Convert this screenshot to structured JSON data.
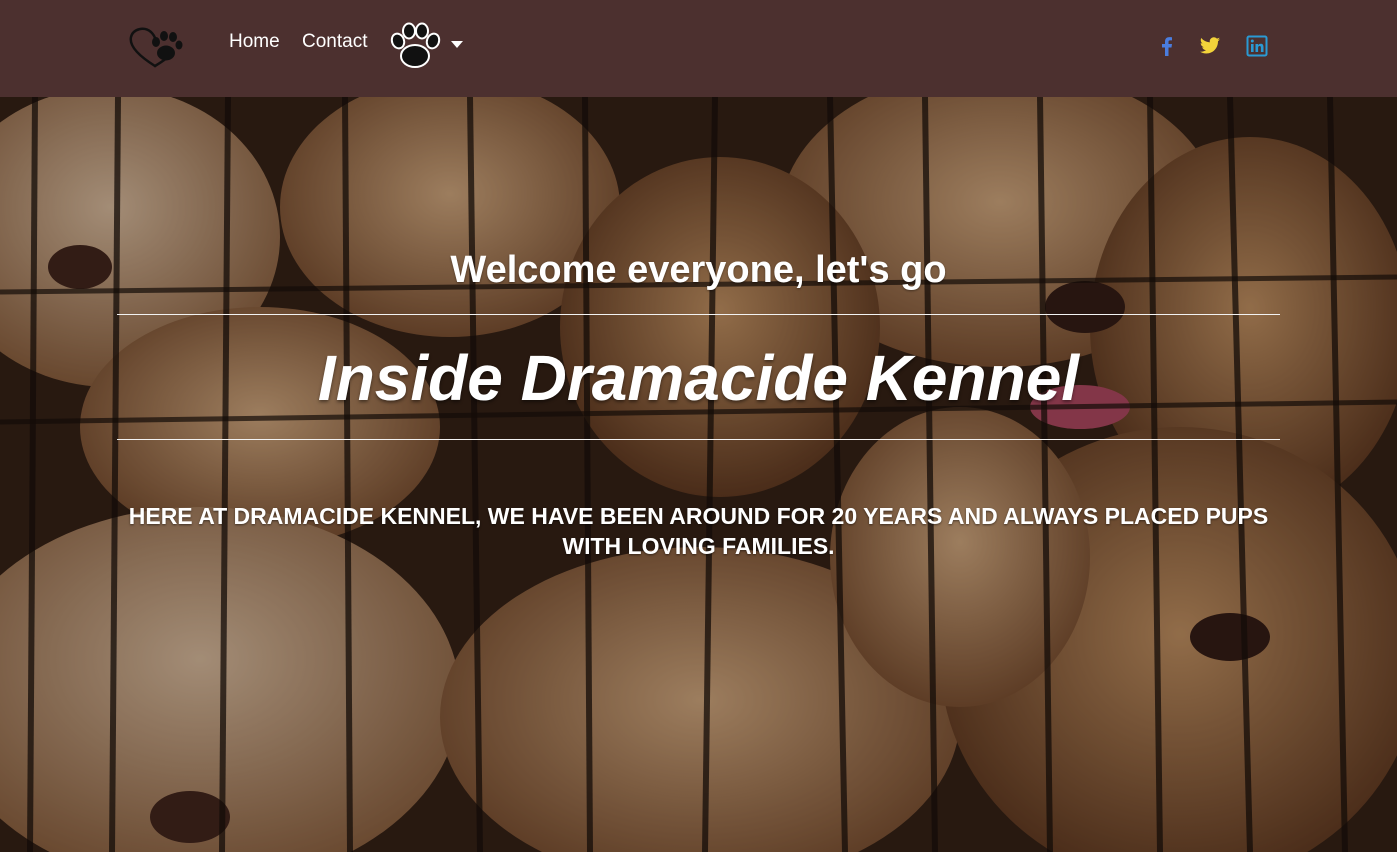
{
  "nav": {
    "logo_icon": "heart-paw-icon",
    "links": [
      {
        "label": "Home"
      },
      {
        "label": "Contact"
      }
    ],
    "dropdown": {
      "icon": "paw-print-icon",
      "caret_icon": "caret-down-icon"
    },
    "social": [
      {
        "icon": "facebook-icon",
        "color": "#4a7ddf"
      },
      {
        "icon": "twitter-icon",
        "color": "#f2d33a"
      },
      {
        "icon": "linkedin-icon",
        "color": "#2a9ad4"
      }
    ],
    "background_color": "#4c302f"
  },
  "hero": {
    "background_image": "puppies-in-kennel-photo",
    "welcome": "Welcome everyone, let's go",
    "title": "Inside Dramacide Kennel",
    "description": "HERE AT DRAMACIDE KENNEL, WE HAVE BEEN AROUND FOR 20 YEARS AND ALWAYS PLACED PUPS WITH LOVING FAMILIES."
  }
}
